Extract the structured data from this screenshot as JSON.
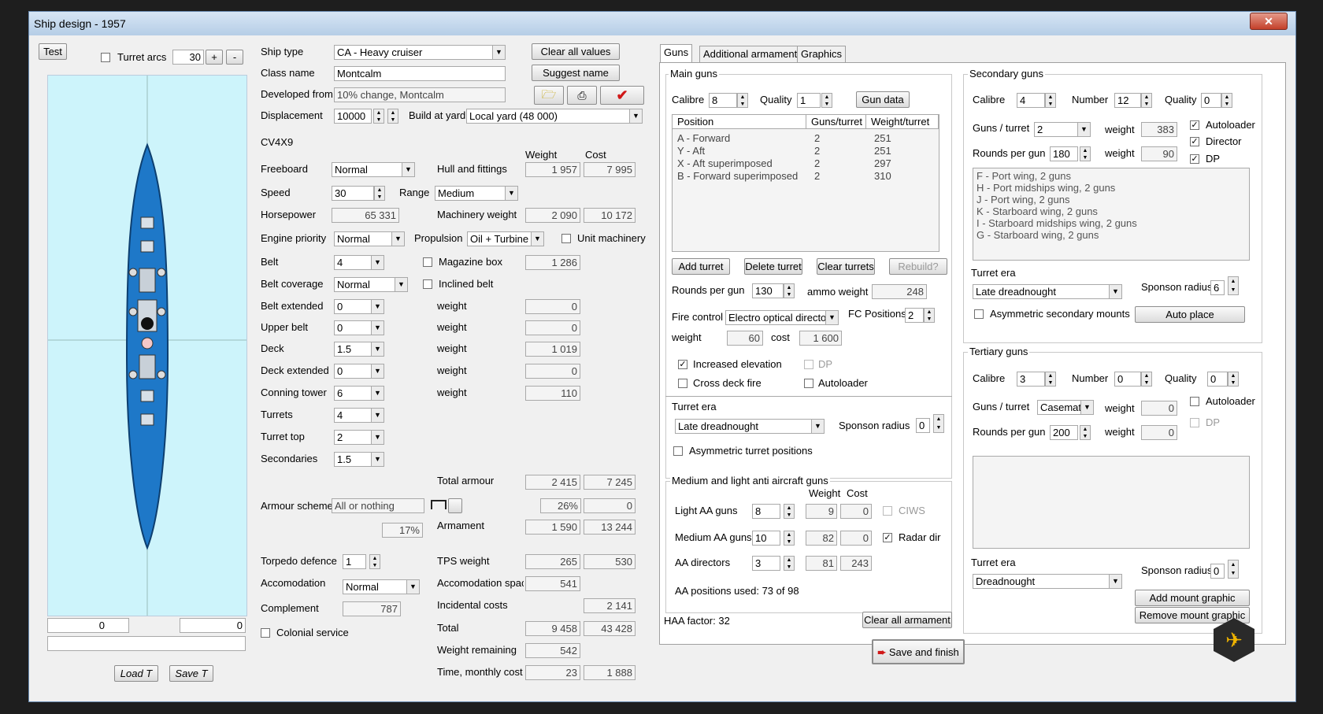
{
  "window": {
    "title": "Ship design - 1957",
    "close": "✕"
  },
  "left": {
    "test_label": "Test",
    "turret_arcs_label": "Turret arcs",
    "turret_arcs_value": "30",
    "plus": "+",
    "minus": "-",
    "bottom_left_value": "0",
    "bottom_right_value": "0",
    "load_label": "Load T",
    "save_label": "Save T"
  },
  "form": {
    "ship_type_label": "Ship type",
    "ship_type": "CA - Heavy cruiser",
    "clear_all_values": "Clear all values",
    "class_name_label": "Class name",
    "class_name": "Montcalm",
    "suggest_name": "Suggest name",
    "developed_from_label": "Developed from",
    "developed_from": "10% change, Montcalm",
    "displacement_label": "Displacement",
    "displacement": "10000",
    "build_at_yard_label": "Build at yard",
    "build_at_yard": "Local yard (48 000)",
    "code": "CV4X9",
    "weight_header": "Weight",
    "cost_header": "Cost",
    "freeboard_label": "Freeboard",
    "freeboard": "Normal",
    "hull_label": "Hull and fittings",
    "hull_weight": "1 957",
    "hull_cost": "7 995",
    "speed_label": "Speed",
    "speed": "30",
    "range_label": "Range",
    "range": "Medium",
    "horsepower_label": "Horsepower",
    "horsepower": "65 331",
    "machinery_label": "Machinery weight",
    "machinery_weight": "2 090",
    "machinery_cost": "10 172",
    "engine_priority_label": "Engine priority",
    "engine_priority": "Normal",
    "propulsion_label": "Propulsion",
    "propulsion": "Oil + Turbine",
    "unit_machinery_label": "Unit machinery",
    "belt_label": "Belt",
    "belt": "4",
    "magazine_box_label": "Magazine box",
    "magazine_weight": "1 286",
    "belt_coverage_label": "Belt coverage",
    "belt_coverage": "Normal",
    "inclined_belt_label": "Inclined belt",
    "belt_extended_label": "Belt extended",
    "belt_extended": "0",
    "upper_belt_label": "Upper belt",
    "upper_belt": "0",
    "deck_label": "Deck",
    "deck": "1.5",
    "deck_extended_label": "Deck extended",
    "deck_extended": "0",
    "conning_tower_label": "Conning tower",
    "conning_tower": "6",
    "turrets_label": "Turrets",
    "turrets": "4",
    "turret_top_label": "Turret top",
    "turret_top": "2",
    "secondaries_label": "Secondaries",
    "secondaries": "1.5",
    "weight_word": "weight",
    "belt_ext_weight": "0",
    "upper_belt_weight": "0",
    "deck_weight": "1 019",
    "deck_ext_weight": "0",
    "conning_weight": "110",
    "total_armour_label": "Total armour",
    "total_armour_weight": "2 415",
    "total_armour_cost": "7 245",
    "armour_scheme_label": "Armour scheme",
    "armour_scheme": "All or nothing",
    "pct_26": "26%",
    "pct_26_cost": "0",
    "pct_17": "17%",
    "armament_label": "Armament",
    "armament_weight": "1 590",
    "armament_cost": "13 244",
    "torpedo_label": "Torpedo defence",
    "torpedo": "1",
    "tps_label": "TPS weight",
    "tps_weight": "265",
    "tps_cost": "530",
    "accom_label": "Accomodation",
    "accom": "Normal",
    "accom_space_label": "Accomodation space",
    "accom_space": "541",
    "complement_label": "Complement",
    "complement": "787",
    "incidental_label": "Incidental costs",
    "incidental_cost": "2 141",
    "total_label": "Total",
    "total_weight": "9 458",
    "total_cost": "43 428",
    "colonial_label": "Colonial service",
    "weight_remaining_label": "Weight remaining",
    "weight_remaining": "542",
    "time_label": "Time, monthly cost",
    "time": "23",
    "monthly_cost": "1 888"
  },
  "tabs": [
    "Guns",
    "Additional armament",
    "Graphics"
  ],
  "main_guns": {
    "title": "Main guns",
    "calibre_label": "Calibre",
    "calibre": "8",
    "quality_label": "Quality",
    "quality": "1",
    "gun_data": "Gun data",
    "columns": [
      "Position",
      "Guns/turret",
      "Weight/turret"
    ],
    "rows": [
      {
        "position": "A - Forward",
        "guns": "2",
        "weight": "251"
      },
      {
        "position": "Y - Aft",
        "guns": "2",
        "weight": "251"
      },
      {
        "position": "X - Aft superimposed",
        "guns": "2",
        "weight": "297"
      },
      {
        "position": "B - Forward superimposed",
        "guns": "2",
        "weight": "310"
      }
    ],
    "add_turret": "Add turret",
    "delete_turret": "Delete turret",
    "clear_turrets": "Clear turrets",
    "rebuild": "Rebuild?",
    "rounds_label": "Rounds per gun",
    "rounds": "130",
    "ammo_label": "ammo weight",
    "ammo_weight": "248",
    "fire_control_label": "Fire control",
    "fire_control": "Electro optical director",
    "fc_positions_label": "FC Positions",
    "fc_positions": "2",
    "weight_label": "weight",
    "fc_weight": "60",
    "cost_label": "cost",
    "fc_cost": "1 600",
    "increased_elevation": "Increased elevation",
    "dp": "DP",
    "cross_deck": "Cross deck fire",
    "autoloader": "Autoloader",
    "turret_era_label": "Turret era",
    "turret_era": "Late dreadnought",
    "sponson_label": "Sponson radius",
    "sponson": "0",
    "asymmetric": "Asymmetric turret positions"
  },
  "aa": {
    "title": "Medium and light anti aircraft guns",
    "weight_header": "Weight",
    "cost_header": "Cost",
    "light_label": "Light AA guns",
    "light": "8",
    "light_weight": "9",
    "light_cost": "0",
    "ciws": "CIWS",
    "medium_label": "Medium AA guns",
    "medium": "10",
    "medium_weight": "82",
    "medium_cost": "0",
    "radar_dir": "Radar dir",
    "directors_label": "AA directors",
    "directors": "3",
    "directors_weight": "81",
    "directors_cost": "243",
    "positions_used": "AA positions used: 73 of 98"
  },
  "haa": "HAA factor: 32",
  "clear_all_armament": "Clear all armament",
  "save_finish": "Save and finish",
  "secondary": {
    "title": "Secondary guns",
    "calibre_label": "Calibre",
    "calibre": "4",
    "number_label": "Number",
    "number": "12",
    "quality_label": "Quality",
    "quality": "0",
    "guns_turret_label": "Guns / turret",
    "guns_turret": "2",
    "weight_label": "weight",
    "weight1": "383",
    "weight2": "90",
    "autoloader": "Autoloader",
    "director": "Director",
    "dp": "DP",
    "rounds_label": "Rounds per gun",
    "rounds": "180",
    "list": [
      "F - Port wing, 2 guns",
      "H - Port midships wing, 2 guns",
      "J - Port wing, 2 guns",
      "K - Starboard wing, 2 guns",
      "I - Starboard midships wing, 2 guns",
      "G - Starboard wing, 2 guns"
    ],
    "turret_era_label": "Turret era",
    "turret_era": "Late dreadnought",
    "sponson_label": "Sponson radius",
    "sponson": "6",
    "asymmetric": "Asymmetric secondary mounts",
    "auto_place": "Auto place"
  },
  "tertiary": {
    "title": "Tertiary guns",
    "calibre_label": "Calibre",
    "calibre": "3",
    "number_label": "Number",
    "number": "0",
    "quality_label": "Quality",
    "quality": "0",
    "guns_turret_label": "Guns / turret",
    "guns_turret": "Casemat",
    "weight_label": "weight",
    "weight1": "0",
    "weight2": "0",
    "autoloader": "Autoloader",
    "dp": "DP",
    "rounds_label": "Rounds per gun",
    "rounds": "200",
    "turret_era_label": "Turret era",
    "turret_era": "Dreadnought",
    "sponson_label": "Sponson radius",
    "sponson": "0",
    "add_mount": "Add mount graphic",
    "remove_mount": "Remove mount graphic"
  },
  "colors": {
    "ship_bg": "#cdf4fb",
    "hull": "#1e78c8",
    "accent_red": "#d01818"
  },
  "icons": [
    "open-folder-icon",
    "print-icon",
    "check-icon",
    "close-icon",
    "app-logo-icon"
  ]
}
